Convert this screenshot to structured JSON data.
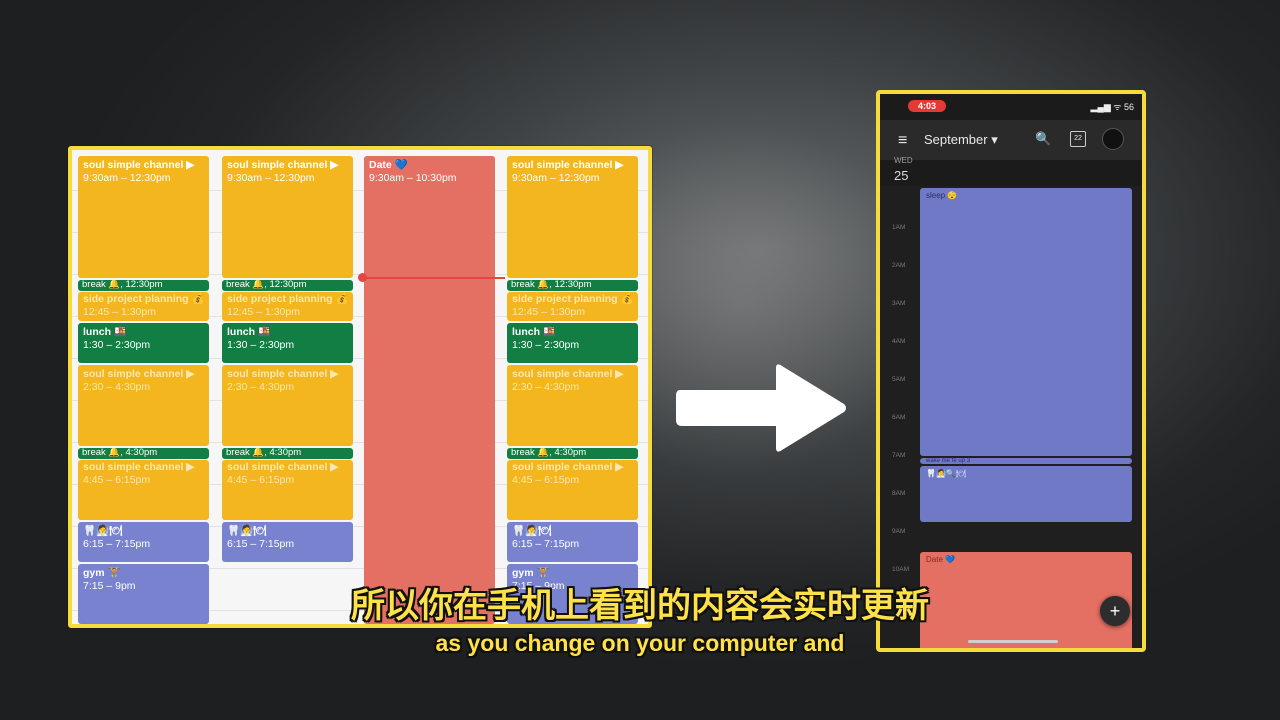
{
  "desktop": {
    "columns": [
      {
        "events": [
          {
            "title": "soul simple channel ▶",
            "time": "9:30am – 12:30pm"
          },
          {
            "title": "break 🔔, 12:30pm"
          },
          {
            "title": "side project planning 💰",
            "time": "12:45 – 1:30pm"
          },
          {
            "title": "lunch 🍱",
            "time": "1:30 – 2:30pm"
          },
          {
            "title": "soul simple channel ▶",
            "time": "2:30 – 4:30pm"
          },
          {
            "title": "break 🔔, 4:30pm"
          },
          {
            "title": "soul simple channel ▶",
            "time": "4:45 – 6:15pm"
          },
          {
            "title": "🦷🧖🍽",
            "time": "6:15 – 7:15pm"
          },
          {
            "title": "gym 🏋",
            "time": "7:15 – 9pm"
          }
        ]
      },
      {
        "events": [
          {
            "title": "soul simple channel ▶",
            "time": "9:30am – 12:30pm"
          },
          {
            "title": "break 🔔, 12:30pm"
          },
          {
            "title": "side project planning 💰",
            "time": "12:45 – 1:30pm"
          },
          {
            "title": "lunch 🍱",
            "time": "1:30 – 2:30pm"
          },
          {
            "title": "soul simple channel ▶",
            "time": "2:30 – 4:30pm"
          },
          {
            "title": "break 🔔, 4:30pm"
          },
          {
            "title": "soul simple channel ▶",
            "time": "4:45 – 6:15pm"
          },
          {
            "title": "🦷🧖🍽",
            "time": "6:15 – 7:15pm"
          }
        ]
      },
      {
        "events": [
          {
            "title": "Date 💙",
            "time": "9:30am – 10:30pm"
          }
        ]
      },
      {
        "events": [
          {
            "title": "soul simple channel ▶",
            "time": "9:30am – 12:30pm"
          },
          {
            "title": "break 🔔, 12:30pm"
          },
          {
            "title": "side project planning 💰",
            "time": "12:45 – 1:30pm"
          },
          {
            "title": "lunch 🍱",
            "time": "1:30 – 2:30pm"
          },
          {
            "title": "soul simple channel ▶",
            "time": "2:30 – 4:30pm"
          },
          {
            "title": "break 🔔, 4:30pm"
          },
          {
            "title": "soul simple channel ▶",
            "time": "4:45 – 6:15pm"
          },
          {
            "title": "🦷🧖🍽",
            "time": "6:15 – 7:15pm"
          },
          {
            "title": "gym 🏋",
            "time": "7:15 – 9pm"
          }
        ]
      }
    ],
    "colors": {
      "yellow": "#f3b61f",
      "green": "#137e43",
      "purple": "#7982cf",
      "red": "#e46f63",
      "now_line": "#e3473f"
    }
  },
  "phone": {
    "status_time": "4:03",
    "status_right": "▂▄▆ ᯤ 56",
    "month": "September ▾",
    "today_badge": "22",
    "day_label": "WED",
    "day_number": "25",
    "hours": [
      "1AM",
      "2AM",
      "3AM",
      "4AM",
      "5AM",
      "6AM",
      "7AM",
      "8AM",
      "9AM",
      "10AM"
    ],
    "events": [
      {
        "title": "sleep 😴"
      },
      {
        "title": "wake me fe up 3"
      },
      {
        "title": "🦷🧖🔍🍽"
      },
      {
        "title": "Date 💙"
      }
    ],
    "fab": "+"
  },
  "subtitles": {
    "zh": "所以你在手机上看到的内容会实时更新",
    "en": "as you change on your computer and"
  }
}
